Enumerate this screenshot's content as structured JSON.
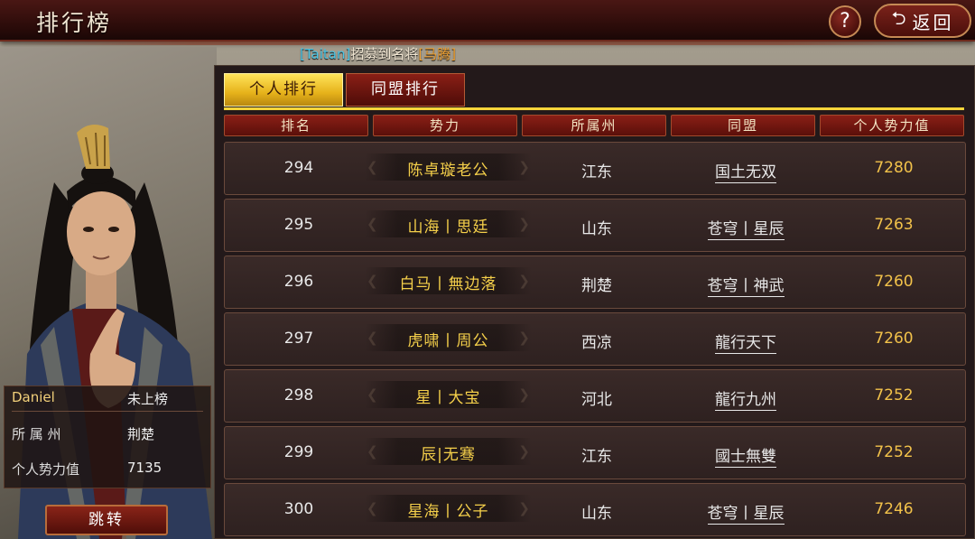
{
  "header": {
    "title": "排行榜",
    "help_label": "?",
    "back_label": "返回"
  },
  "announcement": {
    "user": "[Taitan]",
    "text": "招募到名将",
    "hero": "[马腾]"
  },
  "tabs": [
    {
      "label": "个人排行",
      "active": true
    },
    {
      "label": "同盟排行",
      "active": false
    }
  ],
  "columns": [
    "排名",
    "势力",
    "所属州",
    "同盟",
    "个人势力值"
  ],
  "rows": [
    {
      "rank": "294",
      "name": "陈卓璇老公",
      "state": "江东",
      "alliance": "国土无双",
      "power": "7280"
    },
    {
      "rank": "295",
      "name": "山海丨思廷",
      "state": "山东",
      "alliance": "苍穹丨星辰",
      "power": "7263"
    },
    {
      "rank": "296",
      "name": "白马丨無边落",
      "state": "荆楚",
      "alliance": "苍穹丨神武",
      "power": "7260"
    },
    {
      "rank": "297",
      "name": "虎啸丨周公",
      "state": "西凉",
      "alliance": "龍行天下",
      "power": "7260"
    },
    {
      "rank": "298",
      "name": "星丨大宝",
      "state": "河北",
      "alliance": "龍行九州",
      "power": "7252"
    },
    {
      "rank": "299",
      "name": "辰|无骞",
      "state": "江东",
      "alliance": "國士無雙",
      "power": "7252"
    },
    {
      "rank": "300",
      "name": "星海丨公子",
      "state": "山东",
      "alliance": "苍穹丨星辰",
      "power": "7246"
    }
  ],
  "player": {
    "name": "Daniel",
    "rank_status": "未上榜",
    "state_label": "所 属 州",
    "state_value": "荆楚",
    "power_label": "个人势力值",
    "power_value": "7135"
  },
  "jump_label": "跳转",
  "colors": {
    "accent_gold": "#f5d04a",
    "tab_active": "#ffe35a",
    "button_red": "#8a1f16"
  }
}
